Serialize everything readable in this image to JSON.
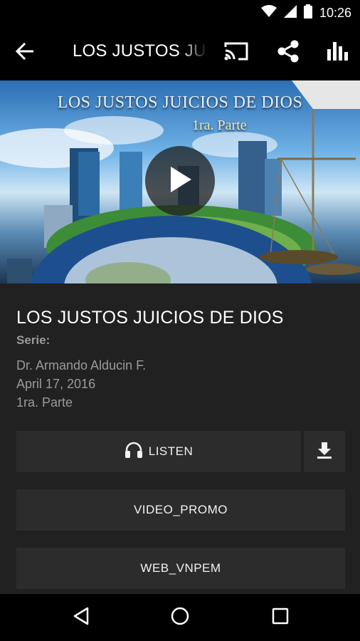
{
  "status_bar": {
    "time": "10:26",
    "icons": [
      "wifi-icon",
      "cell-signal-icon",
      "battery-icon"
    ]
  },
  "toolbar": {
    "title": "LOS JUSTOS JUICIOS DE DIOS",
    "icons": [
      "back-arrow-icon",
      "cast-icon",
      "share-icon",
      "stats-icon"
    ]
  },
  "hero": {
    "title": "LOS JUSTOS JUICIOS DE DIOS",
    "subtitle": "1ra. Parte",
    "play_icon": "play-icon"
  },
  "episode": {
    "title": "LOS JUSTOS JUICIOS DE DIOS",
    "serie_label": "Serie:",
    "author": "Dr. Armando Alducin F.",
    "date": "April 17, 2016",
    "part": "1ra. Parte"
  },
  "actions": {
    "listen_label": "LISTEN",
    "listen_icon": "headphones-icon",
    "download_icon": "download-icon",
    "video_label": "VIDEO_PROMO",
    "web_label": "WEB_VNPEM"
  },
  "navbar": {
    "icons": [
      "nav-back-icon",
      "nav-home-icon",
      "nav-recent-icon"
    ]
  },
  "colors": {
    "background": "#212121",
    "button": "#2c2c2c",
    "secondary_text": "#9a9a9a",
    "bars": "#000000"
  }
}
